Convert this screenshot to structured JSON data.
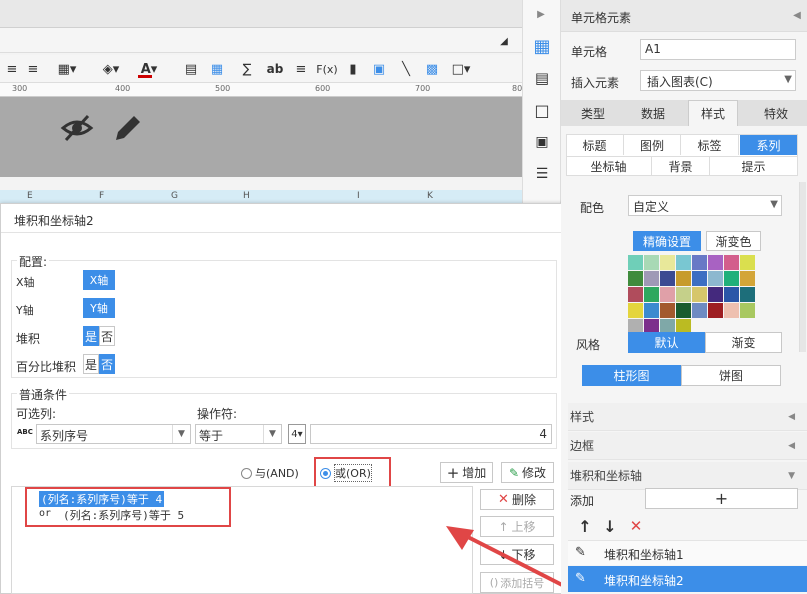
{
  "toolbar": {
    "tools": [
      "fx-icon-label"
    ],
    "fx": "F(x)",
    "ab": "ab"
  },
  "ruler": {
    "ticks": [
      "300",
      "400",
      "500",
      "600",
      "700",
      "80"
    ]
  },
  "columns": [
    "E",
    "F",
    "G",
    "H",
    "I",
    "K"
  ],
  "dialog": {
    "title": "堆积和坐标轴2",
    "config_title": "配置:",
    "rows": [
      {
        "label": "X轴",
        "value": "X轴"
      },
      {
        "label": "Y轴",
        "value": "Y轴"
      },
      {
        "label": "堆积",
        "on": "是",
        "off": "否"
      },
      {
        "label": "百分比堆积",
        "on": "是",
        "off": "否"
      }
    ],
    "cond_title": "普通条件",
    "optional_col_label": "可选列:",
    "operator_label": "操作符:",
    "optional_col_value": "系列序号",
    "abc": "ABC",
    "operator_value": "等于",
    "value": "4",
    "radio_and": "与(AND)",
    "radio_or": "或(OR)",
    "add_btn": "增加",
    "modify_btn": "修改",
    "delete_btn": "删除",
    "up_btn": "上移",
    "down_btn": "下移",
    "bracket_btn": "添加括号",
    "cond_line1": "(列名:系列序号)等于 4",
    "cond_line2_prefix": "or",
    "cond_line2": "(列名:系列序号)等于 5"
  },
  "panel": {
    "title": "单元格元素",
    "cell_label": "单元格",
    "cell_value": "A1",
    "insert_label": "插入元素",
    "insert_value": "插入图表(C)",
    "tabs": [
      "类型",
      "数据",
      "样式",
      "特效"
    ],
    "subtabs1": [
      "标题",
      "图例",
      "标签",
      "系列"
    ],
    "subtabs2": [
      "坐标轴",
      "背景",
      "提示"
    ],
    "color_label": "配色",
    "color_value": "自定义",
    "precise_btn": "精确设置",
    "gradient_btn": "渐变色",
    "style_label": "风格",
    "style_default": "默认",
    "style_gradient": "渐变",
    "bar_chart": "柱形图",
    "pie_chart": "饼图",
    "section_style": "样式",
    "section_border": "边框",
    "section_stack": "堆积和坐标轴",
    "add_label": "添加",
    "add_plus": "+",
    "list_item1": "堆积和坐标轴1",
    "list_item2": "堆积和坐标轴2"
  },
  "colors": {
    "accent": "#3c8ee8",
    "highlight_red": "#e04646",
    "palette": [
      "#6fcfb8",
      "#a8d9b5",
      "#e8e89a",
      "#79c7d2",
      "#6879c6",
      "#a862c2",
      "#d35e8c",
      "#dadf4e",
      "#3f8b3c",
      "#9f99b6",
      "#3c4a92",
      "#c79b2c",
      "#3c6ec2",
      "#8db8cf",
      "#1fb07a",
      "#d3a538",
      "#b04c5c",
      "#2ea85f",
      "#e0a0a8",
      "#c5d08a",
      "#d6c66b",
      "#44297d",
      "#2a56a8",
      "#1d6e7a",
      "#e4d53e",
      "#3c8bcf",
      "#a3592e",
      "#1a5b2e",
      "#6e8bc2",
      "#9e1e22",
      "#eec0b0",
      "#a8c860",
      "#b0b0b0",
      "#7c2f8c",
      "#7fa8a8",
      "#bbbb22"
    ]
  }
}
